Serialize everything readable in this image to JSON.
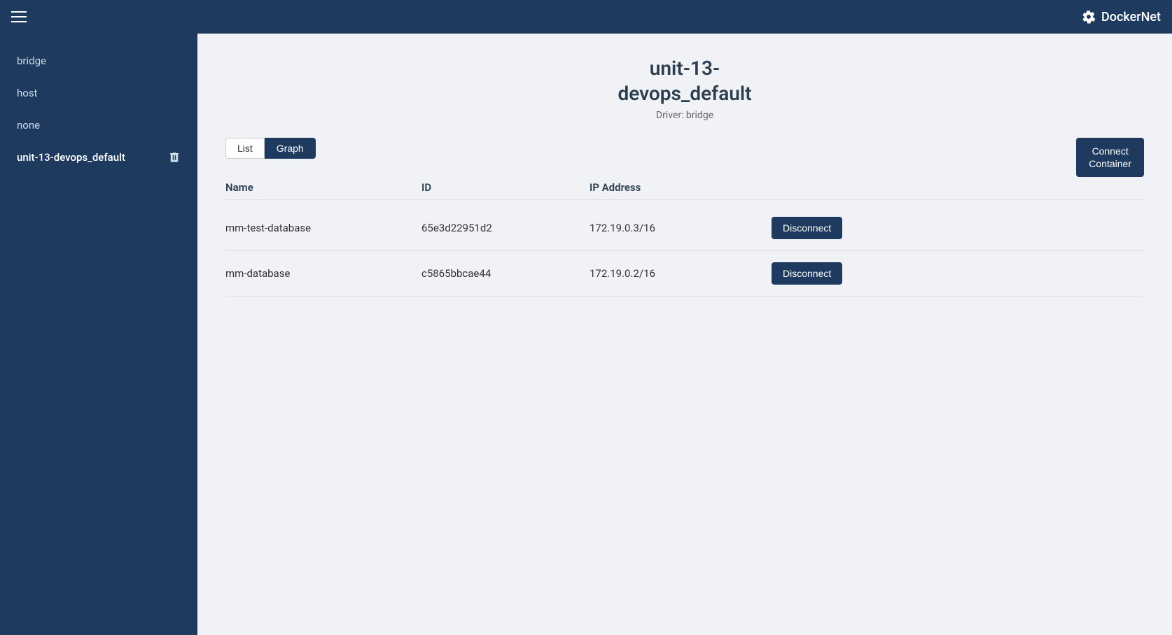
{
  "header": {
    "brand": "DockerNet",
    "menu_icon": "menu"
  },
  "sidebar": {
    "items": [
      {
        "id": "bridge",
        "label": "bridge",
        "active": false
      },
      {
        "id": "host",
        "label": "host",
        "active": false
      },
      {
        "id": "none",
        "label": "none",
        "active": false
      },
      {
        "id": "unit-13-devops_default",
        "label": "unit-13-devops_default",
        "active": true
      }
    ]
  },
  "main": {
    "title_line1": "unit-13-",
    "title_line2": "devops_default",
    "driver_label": "Driver: bridge",
    "tabs": [
      {
        "id": "list",
        "label": "List",
        "active": false
      },
      {
        "id": "graph",
        "label": "Graph",
        "active": true
      }
    ],
    "connect_button_label": "Connect\nContainer",
    "table": {
      "headers": [
        "Name",
        "ID",
        "IP Address",
        ""
      ],
      "rows": [
        {
          "name": "mm-test-database",
          "id": "65e3d22951d2",
          "ip": "172.19.0.3/16",
          "action": "Disconnect"
        },
        {
          "name": "mm-database",
          "id": "c5865bbcae44",
          "ip": "172.19.0.2/16",
          "action": "Disconnect"
        }
      ]
    }
  }
}
